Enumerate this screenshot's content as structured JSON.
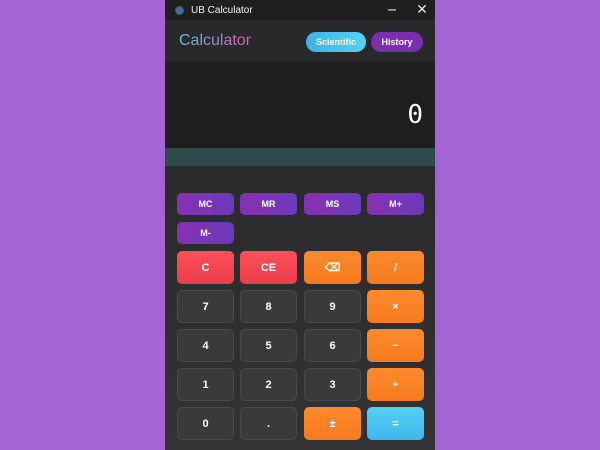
{
  "window": {
    "title": "UB Calculator",
    "minimize_icon": "minimize-icon",
    "close_icon": "close-icon"
  },
  "header": {
    "brand": "Calculator",
    "scientific_label": "Scientific",
    "history_label": "History"
  },
  "display": {
    "value": "0"
  },
  "memory": [
    "MC",
    "MR",
    "MS",
    "M+",
    "M-"
  ],
  "keys": {
    "row1": [
      "C",
      "CE",
      "⌫",
      "/"
    ],
    "row2": [
      "7",
      "8",
      "9",
      "×"
    ],
    "row3": [
      "4",
      "5",
      "6",
      "−"
    ],
    "row4": [
      "1",
      "2",
      "3",
      "+"
    ],
    "row5": [
      "0",
      ".",
      "±",
      "="
    ]
  },
  "colors": {
    "background": "#a564d3",
    "memory_button": "#8a2fb3",
    "clear_button": "#ff4f5b",
    "operator_button": "#ff8a2e",
    "equals_button": "#55d0f5",
    "number_button": "#3a3a3c"
  }
}
